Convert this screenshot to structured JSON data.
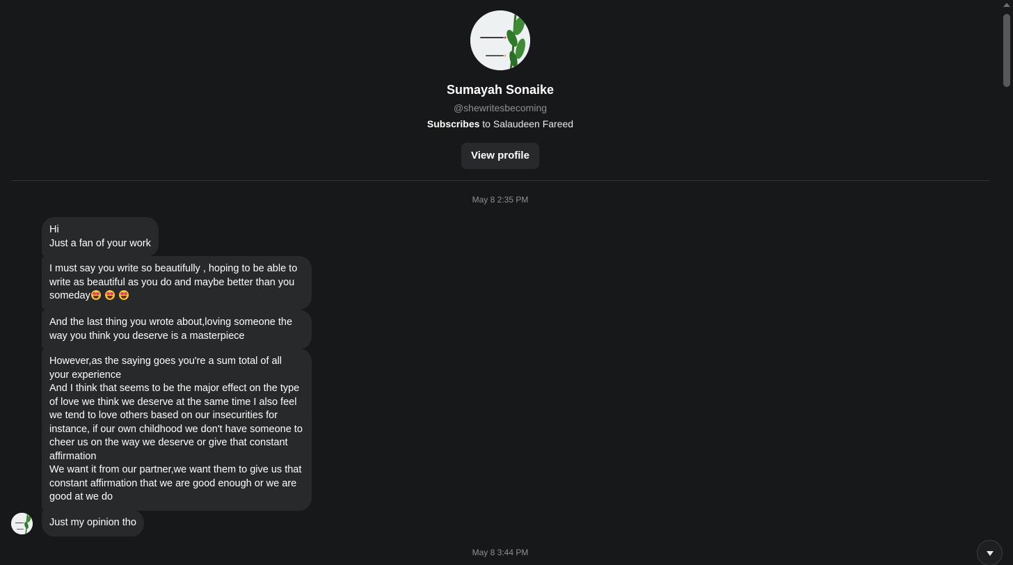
{
  "profile": {
    "display_name": "Sumayah Sonaike",
    "handle": "@shewritesbecoming",
    "subscribe_verb": "Subscribes",
    "subscribe_rest": " to Salaudeen Fareed",
    "view_profile_label": "View profile",
    "avatar_icon": "profile-avatar-plant-icon"
  },
  "conversation": {
    "timestamps": [
      "May 8 2:35 PM",
      "May 8 3:44 PM"
    ],
    "messages": [
      {
        "text": "Hi\nJust a fan of your work"
      },
      {
        "text": "I must say you write so beautifully , hoping to be able to write as beautiful as you do and maybe better than you someday",
        "emoji_count": 3,
        "emoji_icon": "heart-eyes-emoji"
      },
      {
        "text": "And the last thing you wrote about,loving someone the way you think you deserve is a masterpiece"
      },
      {
        "text": "However,as the saying goes you're a sum total of all your experience\nAnd I think that seems to be the major effect on the type of love we think we deserve at the same time I also feel we tend to love others based on our insecurities for instance, if our own childhood we don't have someone to cheer us on the way we deserve or give that constant affirmation\nWe want it from our partner,we want them to give us that constant affirmation that we are good enough or we are good at we do"
      },
      {
        "text": "Just my opinion tho"
      }
    ]
  },
  "controls": {
    "scroll_bottom_icon": "chevron-down-icon"
  },
  "colors": {
    "background": "#17181a",
    "bubble": "#27292b",
    "muted_text": "#8e9093"
  }
}
